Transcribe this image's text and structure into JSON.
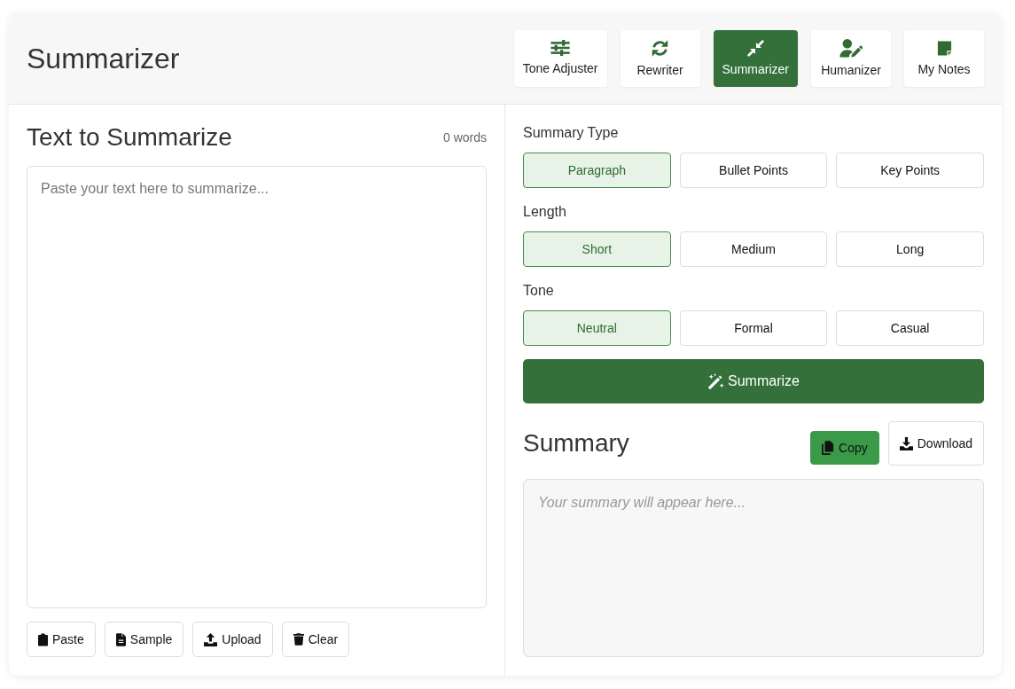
{
  "app": {
    "title": "Summarizer"
  },
  "nav": [
    {
      "label": "Tone Adjuster",
      "selected": false
    },
    {
      "label": "Rewriter",
      "selected": false
    },
    {
      "label": "Summarizer",
      "selected": true
    },
    {
      "label": "Humanizer",
      "selected": false
    },
    {
      "label": "My Notes",
      "selected": false
    }
  ],
  "input_panel": {
    "heading": "Text to Summarize",
    "word_count": "0 words",
    "text_area": {
      "placeholder": "Paste your text here to summarize..."
    },
    "actions": [
      {
        "label": "Paste"
      },
      {
        "label": "Sample"
      },
      {
        "label": "Upload"
      },
      {
        "label": "Clear"
      }
    ]
  },
  "options": [
    {
      "label": "Summary Type",
      "choices": [
        {
          "label": "Paragraph",
          "selected": true
        },
        {
          "label": "Bullet Points",
          "selected": false
        },
        {
          "label": "Key Points",
          "selected": false
        }
      ]
    },
    {
      "label": "Length",
      "choices": [
        {
          "label": "Short",
          "selected": true
        },
        {
          "label": "Medium",
          "selected": false
        },
        {
          "label": "Long",
          "selected": false
        }
      ]
    },
    {
      "label": "Tone",
      "choices": [
        {
          "label": "Neutral",
          "selected": true
        },
        {
          "label": "Formal",
          "selected": false
        },
        {
          "label": "Casual",
          "selected": false
        }
      ]
    }
  ],
  "summarize_button": {
    "label": "Summarize"
  },
  "output_panel": {
    "heading": "Summary",
    "actions": [
      {
        "label": "Copy",
        "kind": "filled"
      },
      {
        "label": "Download",
        "kind": "outlined"
      }
    ],
    "output": {
      "placeholder": "Your summary will appear here..."
    }
  }
}
